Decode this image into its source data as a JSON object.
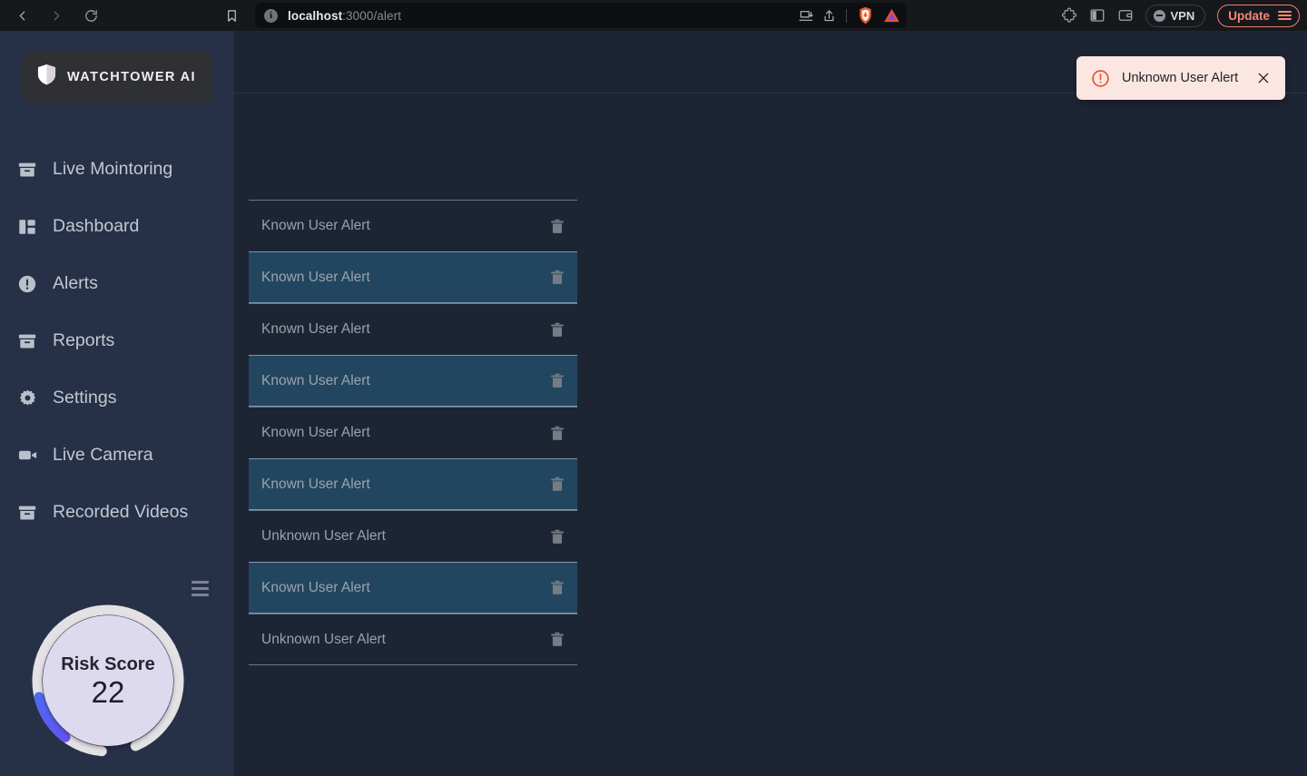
{
  "browser": {
    "back_icon": "chevron-left-icon",
    "forward_icon": "chevron-right-icon",
    "reload_icon": "reload-icon",
    "bookmark_icon": "bookmark-icon",
    "url_host": "localhost",
    "url_path": ":3000/alert",
    "url_full": "localhost:3000/alert",
    "site_info_icon": "site-info-icon",
    "cast_icon": "cast-to-device-icon",
    "share_icon": "share-icon",
    "brave_icon": "brave-shields-icon",
    "extension_triangle_icon": "extension-triangle-icon",
    "puzzle_icon": "extensions-puzzle-icon",
    "sidebar_icon": "toggle-sidebar-icon",
    "wallet_icon": "brave-wallet-icon",
    "vpn_label": "VPN",
    "vpn_icon": "vpn-status-icon",
    "update_label": "Update",
    "update_menu_icon": "hamburger-menu-icon"
  },
  "sidebar": {
    "logo_text": "WATCHTOWER AI",
    "logo_icon": "shield-icon",
    "items": [
      {
        "label": "Live Mointoring",
        "icon": "archive-box-icon"
      },
      {
        "label": "Dashboard",
        "icon": "dashboard-grid-icon"
      },
      {
        "label": "Alerts",
        "icon": "alert-circle-icon"
      },
      {
        "label": "Reports",
        "icon": "archive-box-icon"
      },
      {
        "label": "Settings",
        "icon": "gear-icon"
      },
      {
        "label": "Live Camera",
        "icon": "video-camera-icon"
      },
      {
        "label": "Recorded Videos",
        "icon": "archive-box-icon"
      }
    ],
    "gauge": {
      "title": "Risk Score",
      "value": "22",
      "menu_icon": "hamburger-menu-icon",
      "track_color": "#e3e1e4",
      "progress_color_start": "#1e9bf0",
      "progress_color_end": "#7b3ff2",
      "face_color": "#ddd9ef",
      "percent": 22
    }
  },
  "main": {
    "alerts": [
      {
        "label": "Known User Alert",
        "highlighted": false,
        "delete_icon": "trash-icon"
      },
      {
        "label": "Known User Alert",
        "highlighted": true,
        "delete_icon": "trash-icon"
      },
      {
        "label": "Known User Alert",
        "highlighted": false,
        "delete_icon": "trash-icon"
      },
      {
        "label": "Known User Alert",
        "highlighted": true,
        "delete_icon": "trash-icon"
      },
      {
        "label": "Known User Alert",
        "highlighted": false,
        "delete_icon": "trash-icon"
      },
      {
        "label": "Known User Alert",
        "highlighted": true,
        "delete_icon": "trash-icon"
      },
      {
        "label": "Unknown User Alert",
        "highlighted": false,
        "delete_icon": "trash-icon"
      },
      {
        "label": "Known User Alert",
        "highlighted": true,
        "delete_icon": "trash-icon"
      },
      {
        "label": "Unknown User Alert",
        "highlighted": false,
        "delete_icon": "trash-icon"
      }
    ]
  },
  "toast": {
    "message": "Unknown User Alert",
    "icon": "alert-circle-icon",
    "close_icon": "close-icon",
    "background": "#fbe6e1",
    "icon_color": "#e8502e"
  }
}
